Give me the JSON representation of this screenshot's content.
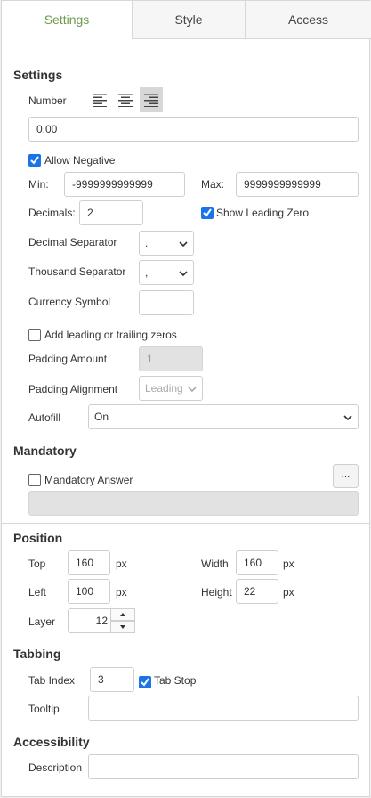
{
  "tabs": [
    {
      "label": "Settings",
      "active": true
    },
    {
      "label": "Style",
      "active": false
    },
    {
      "label": "Access",
      "active": false
    }
  ],
  "settings": {
    "heading": "Settings",
    "number_label": "Number",
    "alignment_selected": "right",
    "value": "0.00",
    "allow_negative_label": "Allow Negative",
    "allow_negative": true,
    "min_label": "Min:",
    "min_value": "-9999999999999",
    "max_label": "Max:",
    "max_value": "9999999999999",
    "decimals_label": "Decimals:",
    "decimals_value": "2",
    "show_leading_zero_label": "Show Leading Zero",
    "show_leading_zero": true,
    "decimal_separator_label": "Decimal Separator",
    "decimal_separator_value": ".",
    "thousand_separator_label": "Thousand Separator",
    "thousand_separator_value": ",",
    "currency_symbol_label": "Currency Symbol",
    "currency_symbol_value": "",
    "add_zeros_label": "Add leading or trailing zeros",
    "add_zeros": false,
    "padding_amount_label": "Padding Amount",
    "padding_amount_value": "1",
    "padding_alignment_label": "Padding Alignment",
    "padding_alignment_value": "Leading",
    "autofill_label": "Autofill",
    "autofill_value": "On"
  },
  "mandatory": {
    "heading": "Mandatory",
    "answer_label": "Mandatory Answer",
    "answer_checked": false,
    "more_button": "...",
    "message_value": ""
  },
  "position": {
    "heading": "Position",
    "top_label": "Top",
    "top_value": "160",
    "top_unit": "px",
    "width_label": "Width",
    "width_value": "160",
    "width_unit": "px",
    "left_label": "Left",
    "left_value": "100",
    "left_unit": "px",
    "height_label": "Height",
    "height_value": "22",
    "height_unit": "px",
    "layer_label": "Layer",
    "layer_value": "12"
  },
  "tabbing": {
    "heading": "Tabbing",
    "tab_index_label": "Tab Index",
    "tab_index_value": "3",
    "tab_stop_label": "Tab Stop",
    "tab_stop": true,
    "tooltip_label": "Tooltip",
    "tooltip_value": ""
  },
  "accessibility": {
    "heading": "Accessibility",
    "description_label": "Description",
    "description_value": ""
  },
  "colors": {
    "active_tab_text": "#6e9b4f",
    "checkbox_checked": "#1a73e8",
    "disabled_field": "#e2e2e2"
  }
}
